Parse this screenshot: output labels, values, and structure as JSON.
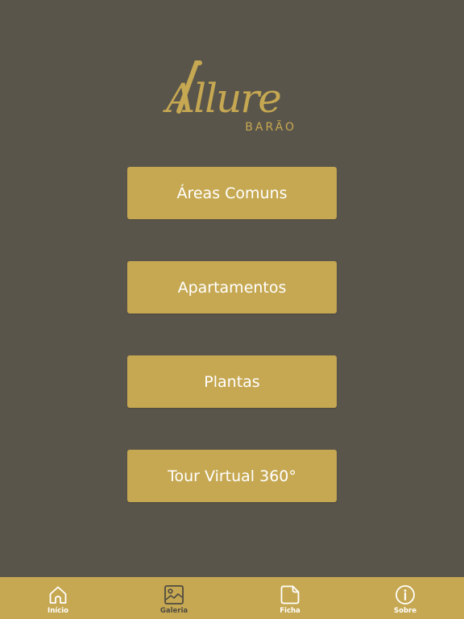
{
  "brand": {
    "name": "Allure",
    "subtitle": "BARÃO",
    "gold_color": "#c6a852",
    "background_color": "#5a554a"
  },
  "menu": {
    "items": [
      {
        "label": "Áreas Comuns"
      },
      {
        "label": "Apartamentos"
      },
      {
        "label": "Plantas"
      },
      {
        "label": "Tour Virtual 360°"
      }
    ]
  },
  "tabbar": {
    "tabs": [
      {
        "label": "Início",
        "icon": "home-icon"
      },
      {
        "label": "Galeria",
        "icon": "gallery-icon",
        "active": true
      },
      {
        "label": "Ficha",
        "icon": "document-icon"
      },
      {
        "label": "Sobre",
        "icon": "info-icon"
      }
    ]
  }
}
